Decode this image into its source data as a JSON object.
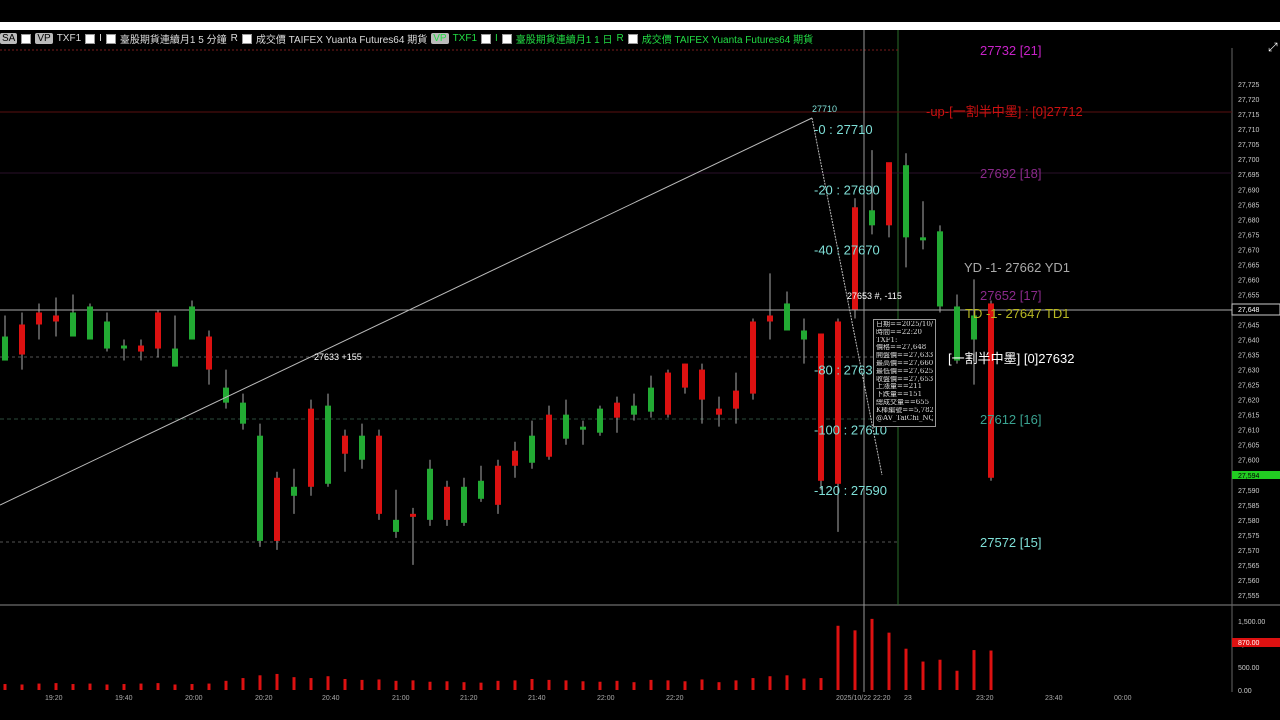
{
  "infobar": {
    "items": [
      {
        "text": "SA",
        "tag": true,
        "arrow": true
      },
      {
        "text": "VP",
        "tag": true
      },
      {
        "text": "TXF1"
      },
      {
        "text": "I"
      },
      {
        "text": "臺股期貨連續月1  5 分鐘"
      },
      {
        "text": "R"
      },
      {
        "text": "成交價  TAIFEX  Yuanta Futures64  期貨"
      },
      {
        "text": "VP",
        "tag": true,
        "green": true
      },
      {
        "text": "TXF1",
        "green": true
      },
      {
        "text": "I",
        "green": true
      },
      {
        "text": "臺股期貨連續月1  1 日",
        "green": true
      },
      {
        "text": "R",
        "green": true
      },
      {
        "text": "成交價  TAIFEX  Yuanta Futures64  期貨",
        "green": true
      }
    ]
  },
  "colors": {
    "up": "#dd1111",
    "down": "#22aa33",
    "fib": "#7fe0d8",
    "magenta": "#c822c8",
    "purple": "#8a2a8a",
    "red_label": "#cc1111",
    "yellow": "#b8b822",
    "gray_label": "#aaaaaa"
  },
  "chart_data": {
    "type": "candlestick",
    "ylim": [
      27552,
      27737
    ],
    "y_ticks": [
      27555,
      27560,
      27565,
      27570,
      27575,
      27580,
      27585,
      27590,
      27595,
      27600,
      27605,
      27610,
      27615,
      27620,
      27625,
      27630,
      27635,
      27640,
      27645,
      27650,
      27655,
      27660,
      27665,
      27670,
      27675,
      27680,
      27685,
      27690,
      27695,
      27700,
      27705,
      27710,
      27715,
      27720,
      27725
    ],
    "candles": [
      {
        "o": 27641,
        "h": 27648,
        "l": 27633,
        "c": 27633
      },
      {
        "o": 27635,
        "h": 27649,
        "l": 27630,
        "c": 27645
      },
      {
        "o": 27645,
        "h": 27652,
        "l": 27640,
        "c": 27649
      },
      {
        "o": 27646,
        "h": 27654,
        "l": 27641,
        "c": 27648
      },
      {
        "o": 27649,
        "h": 27655,
        "l": 27641,
        "c": 27641
      },
      {
        "o": 27651,
        "h": 27652,
        "l": 27640,
        "c": 27640
      },
      {
        "o": 27646,
        "h": 27649,
        "l": 27636,
        "c": 27637
      },
      {
        "o": 27638,
        "h": 27640,
        "l": 27633,
        "c": 27637
      },
      {
        "o": 27636,
        "h": 27640,
        "l": 27633,
        "c": 27638
      },
      {
        "o": 27637,
        "h": 27650,
        "l": 27634,
        "c": 27649
      },
      {
        "o": 27637,
        "h": 27648,
        "l": 27631,
        "c": 27631
      },
      {
        "o": 27651,
        "h": 27653,
        "l": 27640,
        "c": 27640
      },
      {
        "o": 27630,
        "h": 27643,
        "l": 27625,
        "c": 27641
      },
      {
        "o": 27624,
        "h": 27630,
        "l": 27617,
        "c": 27619
      },
      {
        "o": 27619,
        "h": 27622,
        "l": 27610,
        "c": 27612
      },
      {
        "o": 27608,
        "h": 27612,
        "l": 27571,
        "c": 27573
      },
      {
        "o": 27573,
        "h": 27596,
        "l": 27570,
        "c": 27594
      },
      {
        "o": 27591,
        "h": 27597,
        "l": 27582,
        "c": 27588
      },
      {
        "o": 27591,
        "h": 27620,
        "l": 27588,
        "c": 27617
      },
      {
        "o": 27618,
        "h": 27622,
        "l": 27591,
        "c": 27592
      },
      {
        "o": 27602,
        "h": 27610,
        "l": 27596,
        "c": 27608
      },
      {
        "o": 27608,
        "h": 27612,
        "l": 27597,
        "c": 27600
      },
      {
        "o": 27582,
        "h": 27610,
        "l": 27580,
        "c": 27608
      },
      {
        "o": 27580,
        "h": 27590,
        "l": 27574,
        "c": 27576
      },
      {
        "o": 27581,
        "h": 27584,
        "l": 27565,
        "c": 27582
      },
      {
        "o": 27597,
        "h": 27600,
        "l": 27578,
        "c": 27580
      },
      {
        "o": 27580,
        "h": 27593,
        "l": 27578,
        "c": 27591
      },
      {
        "o": 27591,
        "h": 27594,
        "l": 27578,
        "c": 27579
      },
      {
        "o": 27593,
        "h": 27598,
        "l": 27586,
        "c": 27587
      },
      {
        "o": 27585,
        "h": 27600,
        "l": 27582,
        "c": 27598
      },
      {
        "o": 27598,
        "h": 27606,
        "l": 27594,
        "c": 27603
      },
      {
        "o": 27608,
        "h": 27613,
        "l": 27597,
        "c": 27599
      },
      {
        "o": 27601,
        "h": 27618,
        "l": 27600,
        "c": 27615
      },
      {
        "o": 27615,
        "h": 27620,
        "l": 27605,
        "c": 27607
      },
      {
        "o": 27611,
        "h": 27613,
        "l": 27605,
        "c": 27610
      },
      {
        "o": 27617,
        "h": 27618,
        "l": 27608,
        "c": 27609
      },
      {
        "o": 27614,
        "h": 27621,
        "l": 27609,
        "c": 27619
      },
      {
        "o": 27618,
        "h": 27622,
        "l": 27613,
        "c": 27615
      },
      {
        "o": 27624,
        "h": 27628,
        "l": 27614,
        "c": 27616
      },
      {
        "o": 27615,
        "h": 27630,
        "l": 27614,
        "c": 27629
      },
      {
        "o": 27624,
        "h": 27632,
        "l": 27622,
        "c": 27632
      },
      {
        "o": 27620,
        "h": 27632,
        "l": 27612,
        "c": 27630
      },
      {
        "o": 27615,
        "h": 27621,
        "l": 27611,
        "c": 27617
      },
      {
        "o": 27617,
        "h": 27629,
        "l": 27612,
        "c": 27623
      },
      {
        "o": 27622,
        "h": 27647,
        "l": 27620,
        "c": 27646
      },
      {
        "o": 27646,
        "h": 27662,
        "l": 27640,
        "c": 27648
      },
      {
        "o": 27652,
        "h": 27656,
        "l": 27643,
        "c": 27643
      },
      {
        "o": 27643,
        "h": 27647,
        "l": 27632,
        "c": 27640
      },
      {
        "o": 27593,
        "h": 27642,
        "l": 27590,
        "c": 27642
      },
      {
        "o": 27592,
        "h": 27647,
        "l": 27576,
        "c": 27646
      },
      {
        "o": 27650,
        "h": 27687,
        "l": 27647,
        "c": 27684
      },
      {
        "o": 27683,
        "h": 27703,
        "l": 27675,
        "c": 27678
      },
      {
        "o": 27678,
        "h": 27698,
        "l": 27674,
        "c": 27699
      },
      {
        "o": 27698,
        "h": 27702,
        "l": 27664,
        "c": 27674
      },
      {
        "o": 27674,
        "h": 27686,
        "l": 27670,
        "c": 27673
      },
      {
        "o": 27676,
        "h": 27678,
        "l": 27649,
        "c": 27651
      },
      {
        "o": 27651,
        "h": 27655,
        "l": 27632,
        "c": 27633
      },
      {
        "o": 27648,
        "h": 27660,
        "l": 27625,
        "c": 27640
      },
      {
        "o": 27594,
        "h": 27653,
        "l": 27593,
        "c": 27652
      }
    ],
    "volume_ticks": [
      {
        "v": 0,
        "label": "0.00"
      },
      {
        "v": 500,
        "label": "500.00"
      },
      {
        "v": 1000,
        "label": "1,000.00"
      },
      {
        "v": 1500,
        "label": "1,500.00"
      }
    ],
    "volume_max": 1700,
    "volumes": [
      130,
      120,
      140,
      150,
      130,
      140,
      120,
      130,
      140,
      150,
      120,
      130,
      140,
      200,
      260,
      320,
      350,
      280,
      260,
      300,
      240,
      220,
      230,
      200,
      210,
      180,
      190,
      170,
      160,
      200,
      210,
      240,
      220,
      210,
      190,
      180,
      200,
      170,
      220,
      210,
      190,
      230,
      170,
      210,
      260,
      300,
      320,
      250,
      260,
      1400,
      1300,
      1550,
      1250,
      900,
      620,
      660,
      420,
      870,
      860
    ],
    "y_labels": [
      {
        "label": "27,725"
      },
      {
        "label": "27,720"
      },
      {
        "label": "27,715"
      },
      {
        "label": "27,710"
      },
      {
        "label": "27,705"
      },
      {
        "label": "27,700"
      },
      {
        "label": "27,695"
      },
      {
        "label": "27,690"
      },
      {
        "label": "27,685"
      },
      {
        "label": "27,680"
      },
      {
        "label": "27,675"
      },
      {
        "label": "27,670"
      },
      {
        "label": "27,665"
      },
      {
        "label": "27,660"
      },
      {
        "label": "27,655"
      },
      {
        "label": "27,650"
      },
      {
        "label": "27,645"
      },
      {
        "label": "27,640"
      },
      {
        "label": "27,635"
      },
      {
        "label": "27,630"
      },
      {
        "label": "27,625"
      },
      {
        "label": "27,620"
      },
      {
        "label": "27,615"
      },
      {
        "label": "27,610"
      },
      {
        "label": "27,605"
      },
      {
        "label": "27,600"
      },
      {
        "label": "27,595"
      },
      {
        "label": "27,590"
      },
      {
        "label": "27,585"
      },
      {
        "label": "27,580"
      },
      {
        "label": "27,575"
      },
      {
        "label": "27,570"
      },
      {
        "label": "27,565"
      },
      {
        "label": "27,560"
      },
      {
        "label": "27,555"
      }
    ],
    "price_marker_main": "27,648",
    "price_marker_green": "27,594",
    "volume_marker": "870.00",
    "fib_levels": [
      {
        "label": "-0 : 27710",
        "price": 27710
      },
      {
        "label": "-20 : 27690",
        "price": 27690
      },
      {
        "label": "-40 : 27670",
        "price": 27670
      },
      {
        "label": "-80 : 27630",
        "price": 27630
      },
      {
        "label": "-100 : 27610",
        "price": 27610
      },
      {
        "label": "-120 : 27590",
        "price": 27590
      }
    ],
    "right_labels": [
      {
        "text": "27732 [21]",
        "price": 27732,
        "color": "magenta"
      },
      {
        "text": "-up-[一割半中墨] : [0]27712",
        "price": 27712,
        "color": "red_label"
      },
      {
        "text": "27692 [18]",
        "price": 27692,
        "color": "purple"
      },
      {
        "text": "YD -1- 27662 YD1",
        "price": 27662,
        "color": "gray_label"
      },
      {
        "text": "27652 [17]",
        "price": 27652,
        "color": "purple"
      },
      {
        "text": "TD -1- 27647 TD1",
        "price": 27647,
        "color": "yellow"
      },
      {
        "text": "[一割半中墨]  [0]27632",
        "price": 27632,
        "color": "white"
      },
      {
        "text": "27612 [16]",
        "price": 27612,
        "color": "teal"
      },
      {
        "text": "27572 [15]",
        "price": 27572,
        "color": "fib"
      }
    ],
    "annotations": [
      {
        "text": "27710",
        "price": 27713
      },
      {
        "text": "27653 #, -115",
        "price": 27654
      },
      {
        "text": "27633 +155",
        "price": 27633
      }
    ],
    "tooltip_lines": [
      "日期==2025/10/22",
      "時間==22:20",
      "TXF1:",
      "價格==27,648",
      "開盤價==27,633",
      "最高價==27,660",
      "最低價==27,625",
      "收盤價==27,653",
      "上漲量==211",
      "下跌量==151",
      "總成交量==655",
      "K棒編號==5,782",
      "@AV_TaiChi_NQ:"
    ],
    "x_labels": [
      "19:20",
      "19:40",
      "20:00",
      "20:20",
      "20:40",
      "21:00",
      "21:20",
      "21:40",
      "22:00",
      "22:20",
      "2025/10/22 22:20",
      "23",
      "23:20",
      "23:40",
      "00:00"
    ]
  }
}
